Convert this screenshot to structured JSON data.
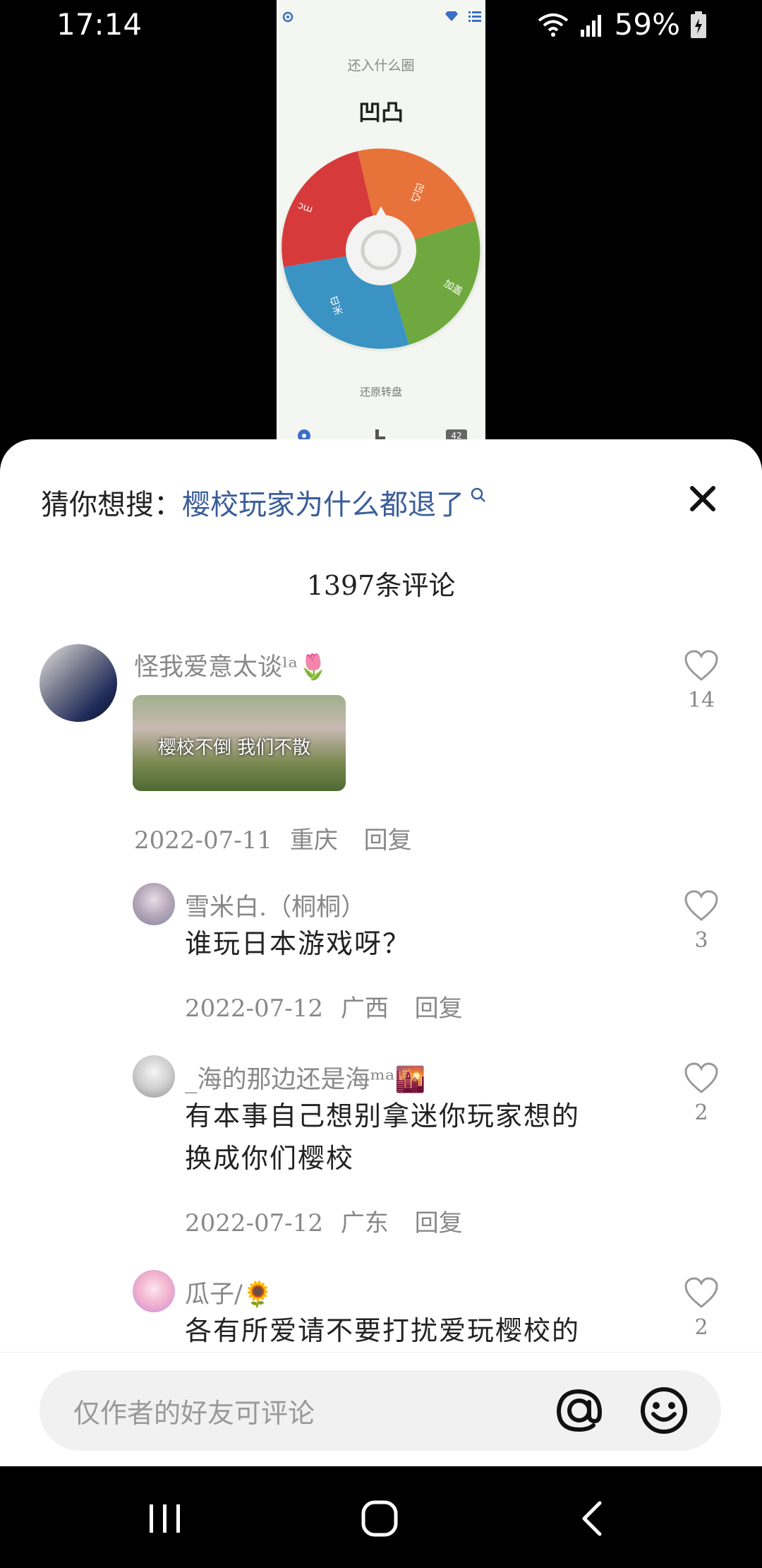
{
  "status_bar": {
    "time": "17:14",
    "battery": "59%"
  },
  "video": {
    "subtitle": "还入什么圈",
    "title": "凹凸",
    "wheel_labels": [
      "凹凸",
      "加盖",
      "米白",
      "mc"
    ],
    "wheel_colors": [
      "#e8733a",
      "#6ea83e",
      "#3b93c4",
      "#d63a3a"
    ],
    "caption": "还原转盘",
    "badge": "42"
  },
  "sheet": {
    "suggest_prefix": "猜你想搜：",
    "suggest_query": "樱校玩家为什么都退了",
    "comment_count": "1397条评论",
    "comments": [
      {
        "name": "怪我爱意太谈ˡᵃ🌷",
        "image_caption": "樱校不倒 我们不散",
        "date": "2022-07-11",
        "region": "重庆",
        "reply": "回复",
        "likes": "14"
      },
      {
        "name": "雪米白.（桐桐）",
        "text": "谁玩日本游戏呀？",
        "date": "2022-07-12",
        "region": "广西",
        "reply": "回复",
        "likes": "3"
      },
      {
        "name": "_海的那边还是海ᵐᵃ🌇",
        "text_line1": "有本事自己想别拿迷你玩家想的",
        "text_line2": "换成你们樱校",
        "date": "2022-07-12",
        "region": "广东",
        "reply": "回复",
        "likes": "2"
      },
      {
        "name": "瓜子/🌻",
        "text": "各有所爱请不要打扰爱玩樱校的",
        "likes": "2"
      }
    ],
    "input_placeholder": "仅作者的好友可评论"
  },
  "colors": {
    "link": "#3a5d9c",
    "heart": "#999999",
    "input_bg": "#f1f1f1"
  },
  "icons": [
    "wifi-icon",
    "signal-icon",
    "battery-icon",
    "settings-icon",
    "diamond-icon",
    "list-icon",
    "search-icon",
    "close-icon",
    "heart-icon",
    "at-icon",
    "emoji-icon",
    "nav-recents-icon",
    "nav-home-icon",
    "nav-back-icon"
  ]
}
